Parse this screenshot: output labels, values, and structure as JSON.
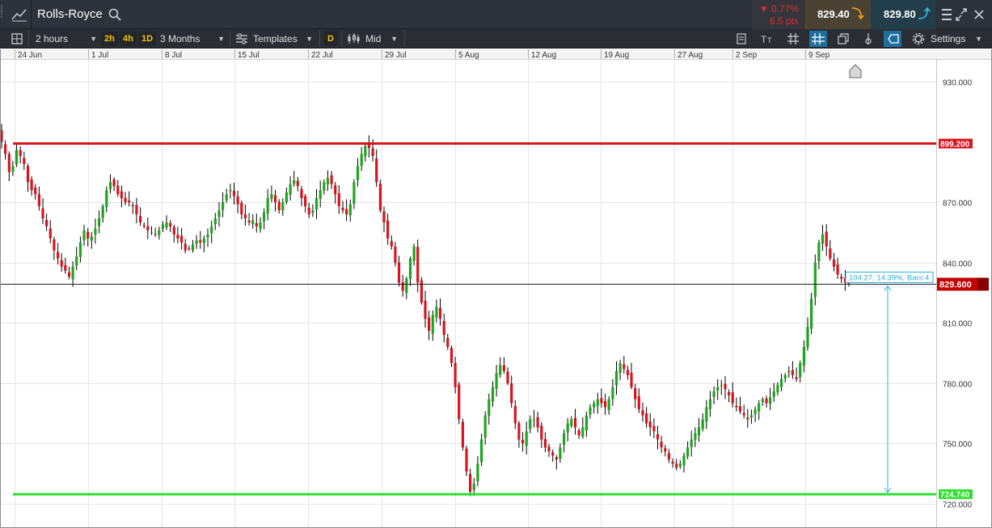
{
  "header": {
    "instrument": "Rolls-Royce",
    "change_pct": "▼ 0.77%",
    "change_pts": "6.5 pts",
    "sell_price": "829.40",
    "buy_price": "829.80"
  },
  "toolbar": {
    "interval": "2 hours",
    "quick_intervals": [
      "2h",
      "4h",
      "1D"
    ],
    "range": "3 Months",
    "templates_label": "Templates",
    "d_label": "D",
    "price_type": "Mid",
    "settings_label": "Settings"
  },
  "colors": {
    "up": "#1ea51e",
    "down": "#d9141e",
    "resistance": "#d9141e",
    "support": "#2ee02e",
    "measure": "#29b1d6",
    "grid": "#e6e6e6"
  },
  "chart_data": {
    "type": "candlestick",
    "x_tick_labels": [
      "24 Jun",
      "1 Jul",
      "8 Jul",
      "15 Jul",
      "22 Jul",
      "29 Jul",
      "5 Aug",
      "12 Aug",
      "19 Aug",
      "27 Aug",
      "2 Sep",
      "9 Sep"
    ],
    "y_ticks": [
      "930.000",
      "870.000",
      "840.000",
      "810.000",
      "780.000",
      "750.000",
      "720.000"
    ],
    "ylim": [
      716,
      948
    ],
    "resistance_level": 899.2,
    "resistance_label": "899.200",
    "support_level": 724.74,
    "support_label": "724.740",
    "current_price": 829.6,
    "current_label": "829.600",
    "measure_label": "104.27, 14.39%, Bars:4",
    "closes": [
      900,
      894,
      885,
      888,
      896,
      893,
      889,
      880,
      876,
      874,
      868,
      862,
      858,
      852,
      846,
      842,
      838,
      836,
      833,
      838,
      843,
      850,
      856,
      852,
      853,
      857,
      862,
      868,
      876,
      880,
      878,
      874,
      872,
      870,
      870,
      868,
      864,
      860,
      858,
      856,
      855,
      854,
      856,
      859,
      860,
      858,
      854,
      852,
      850,
      846,
      847,
      849,
      851,
      850,
      852,
      854,
      858,
      862,
      866,
      870,
      874,
      876,
      873,
      869,
      864,
      862,
      860,
      861,
      858,
      860,
      865,
      872,
      874,
      870,
      866,
      870,
      875,
      879,
      881,
      878,
      872,
      868,
      864,
      866,
      872,
      876,
      880,
      882,
      879,
      874,
      868,
      866,
      864,
      869,
      880,
      888,
      894,
      898,
      897,
      893,
      880,
      866,
      860,
      852,
      848,
      840,
      830,
      826,
      832,
      842,
      848,
      830,
      820,
      812,
      806,
      814,
      818,
      812,
      804,
      798,
      790,
      778,
      762,
      748,
      736,
      726,
      730,
      740,
      752,
      764,
      772,
      778,
      785,
      789,
      786,
      780,
      770,
      760,
      752,
      750,
      756,
      762,
      762,
      758,
      752,
      748,
      746,
      744,
      742,
      748,
      755,
      760,
      762,
      758,
      754,
      758,
      764,
      768,
      770,
      772,
      770,
      768,
      772,
      778,
      786,
      790,
      787,
      784,
      778,
      772,
      767,
      764,
      760,
      758,
      756,
      752,
      748,
      746,
      742,
      740,
      738,
      740,
      744,
      748,
      752,
      755,
      758,
      762,
      768,
      772,
      776,
      778,
      779,
      777,
      774,
      770,
      768,
      766,
      764,
      762,
      764,
      767,
      770,
      772,
      770,
      773,
      776,
      779,
      782,
      784,
      786,
      784,
      782,
      790,
      798,
      808,
      822,
      840,
      850,
      854,
      848,
      842,
      838,
      834,
      832,
      830,
      829.6
    ]
  }
}
